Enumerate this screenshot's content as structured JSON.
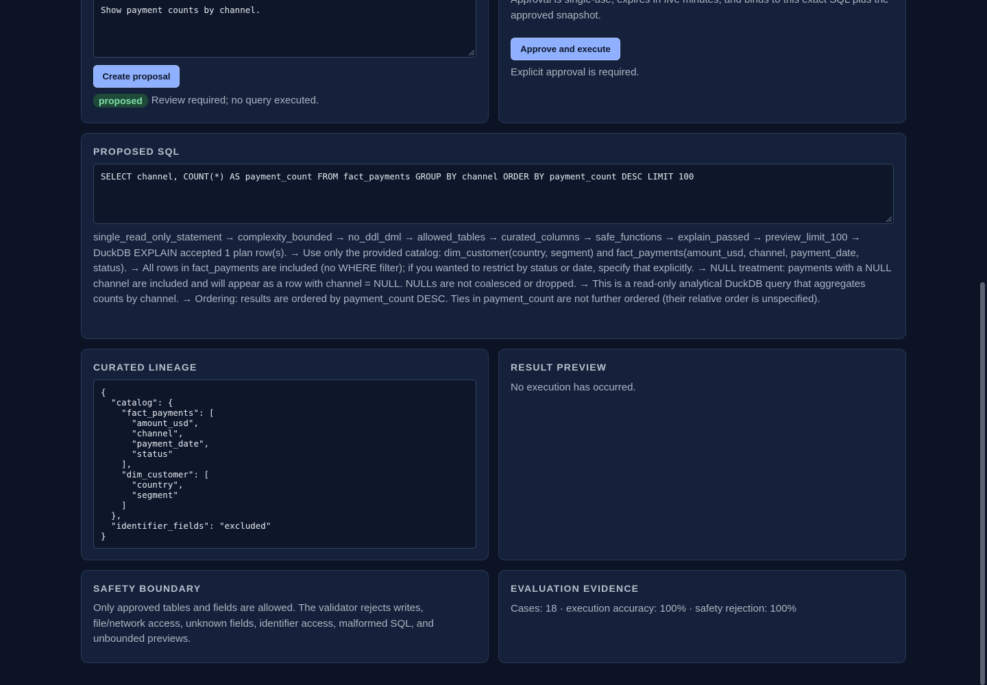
{
  "question_card": {
    "question_text": "Show payment counts by channel.",
    "create_button": "Create proposal",
    "status_badge": "proposed",
    "status_text": "Review required; no query executed."
  },
  "approval_card": {
    "note": "Approval is single-use, expires in five minutes, and binds to this exact SQL plus the approved snapshot.",
    "approve_button": "Approve and execute",
    "requirement": "Explicit approval is required."
  },
  "proposed_sql": {
    "title": "Proposed SQL",
    "sql": "SELECT channel, COUNT(*) AS payment_count FROM fact_payments GROUP BY channel ORDER BY payment_count DESC LIMIT 100",
    "checks": "single_read_only_statement → complexity_bounded → no_ddl_dml → allowed_tables → curated_columns → safe_functions → explain_passed → preview_limit_100 → DuckDB EXPLAIN accepted 1 plan row(s). → Use only the provided catalog: dim_customer(country, segment) and fact_payments(amount_usd, channel, payment_date, status). → All rows in fact_payments are included (no WHERE filter); if you wanted to restrict by status or date, specify that explicitly. → NULL treatment: payments with a NULL channel are included and will appear as a row with channel = NULL. NULLs are not coalesced or dropped. → This is a read-only analytical DuckDB query that aggregates counts by channel. → Ordering: results are ordered by payment_count DESC. Ties in payment_count are not further ordered (their relative order is unspecified)."
  },
  "lineage": {
    "title": "Curated Lineage",
    "json_text": "{\n  \"catalog\": {\n    \"fact_payments\": [\n      \"amount_usd\",\n      \"channel\",\n      \"payment_date\",\n      \"status\"\n    ],\n    \"dim_customer\": [\n      \"country\",\n      \"segment\"\n    ]\n  },\n  \"identifier_fields\": \"excluded\"\n}"
  },
  "result_preview": {
    "title": "Result Preview",
    "message": "No execution has occurred."
  },
  "safety": {
    "title": "Safety Boundary",
    "text": "Only approved tables and fields are allowed. The validator rejects writes, file/network access, unknown fields, identifier access, malformed SQL, and unbounded previews."
  },
  "evaluation": {
    "title": "Evaluation Evidence",
    "text": "Cases: 18 · execution accuracy: 100% · safety rejection: 100%"
  }
}
